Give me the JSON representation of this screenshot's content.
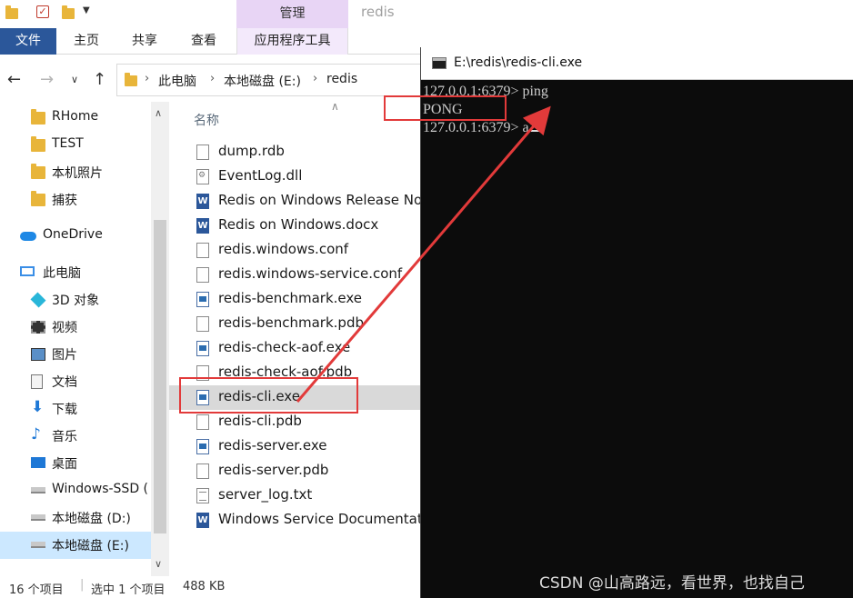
{
  "ribbon": {
    "manage_label": "管理",
    "window_title": "redis",
    "tabs": [
      "文件",
      "主页",
      "共享",
      "查看",
      "应用程序工具"
    ]
  },
  "address": {
    "crumbs": [
      "此电脑",
      "本地磁盘 (E:)",
      "redis"
    ]
  },
  "sidebar": {
    "items": [
      {
        "label": "RHome",
        "icon": "folder-icon"
      },
      {
        "label": "TEST",
        "icon": "folder-icon"
      },
      {
        "label": "本机照片",
        "icon": "folder-icon"
      },
      {
        "label": "捕获",
        "icon": "folder-icon"
      },
      {
        "label": "OneDrive",
        "icon": "cloud-icon"
      },
      {
        "label": "此电脑",
        "icon": "computer-icon"
      },
      {
        "label": "3D 对象",
        "icon": "cube-icon"
      },
      {
        "label": "视频",
        "icon": "video-icon"
      },
      {
        "label": "图片",
        "icon": "picture-icon"
      },
      {
        "label": "文档",
        "icon": "document-icon"
      },
      {
        "label": "下载",
        "icon": "download-icon"
      },
      {
        "label": "音乐",
        "icon": "music-icon"
      },
      {
        "label": "桌面",
        "icon": "desktop-icon"
      },
      {
        "label": "Windows-SSD (",
        "icon": "drive-icon"
      },
      {
        "label": "本地磁盘 (D:)",
        "icon": "drive-icon"
      },
      {
        "label": "本地磁盘 (E:)",
        "icon": "drive-icon"
      }
    ]
  },
  "filelist": {
    "column_header": "名称",
    "files": [
      {
        "name": "dump.rdb",
        "type": "blank"
      },
      {
        "name": "EventLog.dll",
        "type": "dll"
      },
      {
        "name": "Redis on Windows Release Notes.docx",
        "type": "word"
      },
      {
        "name": "Redis on Windows.docx",
        "type": "word"
      },
      {
        "name": "redis.windows.conf",
        "type": "blank"
      },
      {
        "name": "redis.windows-service.conf",
        "type": "blank"
      },
      {
        "name": "redis-benchmark.exe",
        "type": "exe"
      },
      {
        "name": "redis-benchmark.pdb",
        "type": "blank"
      },
      {
        "name": "redis-check-aof.exe",
        "type": "exe"
      },
      {
        "name": "redis-check-aof.pdb",
        "type": "blank"
      },
      {
        "name": "redis-cli.exe",
        "type": "exe"
      },
      {
        "name": "redis-cli.pdb",
        "type": "blank"
      },
      {
        "name": "redis-server.exe",
        "type": "exe"
      },
      {
        "name": "redis-server.pdb",
        "type": "blank"
      },
      {
        "name": "server_log.txt",
        "type": "txt"
      },
      {
        "name": "Windows Service Documentation.docx",
        "type": "word"
      }
    ],
    "selected": "redis-cli.exe"
  },
  "status": {
    "count": "16 个项目",
    "selection": "选中 1 个项目",
    "size": "488 KB"
  },
  "cmd": {
    "title": "E:\\redis\\redis-cli.exe",
    "lines": [
      "127.0.0.1:6379> ping",
      "PONG",
      "127.0.0.1:6379> a"
    ]
  },
  "watermark": "CSDN @山高路远，看世界，也找自己",
  "colors": {
    "accent": "#2b579a",
    "tool_tab": "#e8d5f5",
    "selection": "#cce8ff",
    "annotation": "#e23a3a"
  }
}
